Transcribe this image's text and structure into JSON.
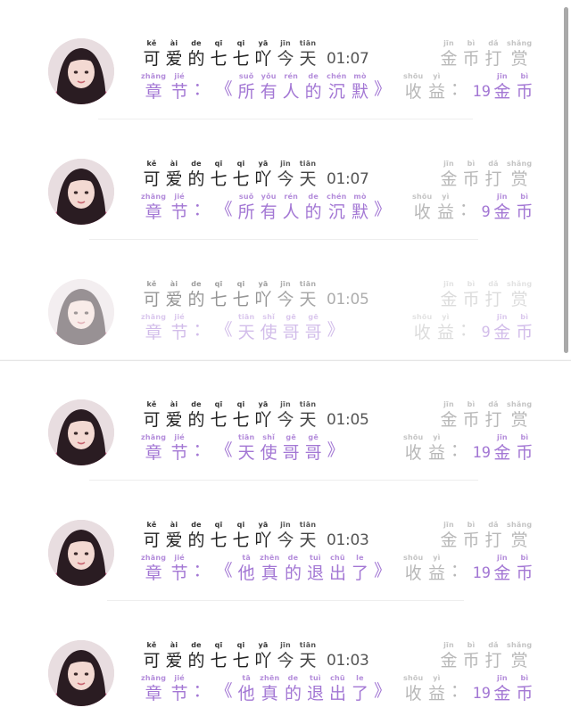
{
  "scrollbar": "vertical scroll bar",
  "colors": {
    "accent": "#a377d4",
    "muted": "#b8b8b8",
    "text": "#222222"
  },
  "rows": [
    {
      "name": [
        {
          "py": "kě",
          "hz": "可"
        },
        {
          "py": "ài",
          "hz": "爱"
        },
        {
          "py": "de",
          "hz": "的"
        },
        {
          "py": "qī",
          "hz": "七"
        },
        {
          "py": "qi",
          "hz": "七"
        },
        {
          "py": "yā",
          "hz": "吖"
        }
      ],
      "date": [
        {
          "py": "jīn",
          "hz": "今"
        },
        {
          "py": "tiān",
          "hz": "天"
        }
      ],
      "time": "01:07",
      "reward": [
        {
          "py": "jīn",
          "hz": "金"
        },
        {
          "py": "bì",
          "hz": "币"
        },
        {
          "py": "dǎ",
          "hz": "打"
        },
        {
          "py": "shǎng",
          "hz": "赏"
        }
      ],
      "chapter_label": [
        {
          "py": "zhāng",
          "hz": "章"
        },
        {
          "py": "jié",
          "hz": "节"
        },
        {
          "py": "",
          "hz": "："
        }
      ],
      "chapter_title": [
        {
          "py": "",
          "hz": "《"
        },
        {
          "py": "suǒ",
          "hz": "所"
        },
        {
          "py": "yǒu",
          "hz": "有"
        },
        {
          "py": "rén",
          "hz": "人"
        },
        {
          "py": "de",
          "hz": "的"
        },
        {
          "py": "chén",
          "hz": "沉"
        },
        {
          "py": "mò",
          "hz": "默"
        },
        {
          "py": "",
          "hz": "》"
        }
      ],
      "income_label": [
        {
          "py": "shōu",
          "hz": "收"
        },
        {
          "py": "yì",
          "hz": "益"
        },
        {
          "py": "",
          "hz": "："
        }
      ],
      "income_amount": "19",
      "income_unit": [
        {
          "py": "jīn",
          "hz": "金"
        },
        {
          "py": "bì",
          "hz": "币"
        }
      ]
    },
    {
      "name": [
        {
          "py": "kě",
          "hz": "可"
        },
        {
          "py": "ài",
          "hz": "爱"
        },
        {
          "py": "de",
          "hz": "的"
        },
        {
          "py": "qī",
          "hz": "七"
        },
        {
          "py": "qi",
          "hz": "七"
        },
        {
          "py": "yā",
          "hz": "吖"
        }
      ],
      "date": [
        {
          "py": "jīn",
          "hz": "今"
        },
        {
          "py": "tiān",
          "hz": "天"
        }
      ],
      "time": "01:07",
      "reward": [
        {
          "py": "jīn",
          "hz": "金"
        },
        {
          "py": "bì",
          "hz": "币"
        },
        {
          "py": "dǎ",
          "hz": "打"
        },
        {
          "py": "shǎng",
          "hz": "赏"
        }
      ],
      "chapter_label": [
        {
          "py": "zhāng",
          "hz": "章"
        },
        {
          "py": "jié",
          "hz": "节"
        },
        {
          "py": "",
          "hz": "："
        }
      ],
      "chapter_title": [
        {
          "py": "",
          "hz": "《"
        },
        {
          "py": "suǒ",
          "hz": "所"
        },
        {
          "py": "yǒu",
          "hz": "有"
        },
        {
          "py": "rén",
          "hz": "人"
        },
        {
          "py": "de",
          "hz": "的"
        },
        {
          "py": "chén",
          "hz": "沉"
        },
        {
          "py": "mò",
          "hz": "默"
        },
        {
          "py": "",
          "hz": "》"
        }
      ],
      "income_label": [
        {
          "py": "shōu",
          "hz": "收"
        },
        {
          "py": "yì",
          "hz": "益"
        },
        {
          "py": "",
          "hz": "："
        }
      ],
      "income_amount": "9",
      "income_unit": [
        {
          "py": "jīn",
          "hz": "金"
        },
        {
          "py": "bì",
          "hz": "币"
        }
      ]
    },
    {
      "faded": true,
      "name": [
        {
          "py": "kě",
          "hz": "可"
        },
        {
          "py": "ài",
          "hz": "爱"
        },
        {
          "py": "de",
          "hz": "的"
        },
        {
          "py": "qī",
          "hz": "七"
        },
        {
          "py": "qi",
          "hz": "七"
        },
        {
          "py": "yā",
          "hz": "吖"
        }
      ],
      "date": [
        {
          "py": "jīn",
          "hz": "今"
        },
        {
          "py": "tiān",
          "hz": "天"
        }
      ],
      "time": "01:05",
      "reward": [
        {
          "py": "jīn",
          "hz": "金"
        },
        {
          "py": "bì",
          "hz": "币"
        },
        {
          "py": "dǎ",
          "hz": "打"
        },
        {
          "py": "shǎng",
          "hz": "赏"
        }
      ],
      "chapter_label": [
        {
          "py": "zhāng",
          "hz": "章"
        },
        {
          "py": "jié",
          "hz": "节"
        },
        {
          "py": "",
          "hz": "："
        }
      ],
      "chapter_title": [
        {
          "py": "",
          "hz": "《"
        },
        {
          "py": "tiān",
          "hz": "天"
        },
        {
          "py": "shǐ",
          "hz": "使"
        },
        {
          "py": "gē",
          "hz": "哥"
        },
        {
          "py": "gē",
          "hz": "哥"
        },
        {
          "py": "",
          "hz": "》"
        }
      ],
      "income_label": [
        {
          "py": "shōu",
          "hz": "收"
        },
        {
          "py": "yì",
          "hz": "益"
        },
        {
          "py": "",
          "hz": "："
        }
      ],
      "income_amount": "9",
      "income_unit": [
        {
          "py": "jīn",
          "hz": "金"
        },
        {
          "py": "bì",
          "hz": "币"
        }
      ]
    },
    {
      "name": [
        {
          "py": "kě",
          "hz": "可"
        },
        {
          "py": "ài",
          "hz": "爱"
        },
        {
          "py": "de",
          "hz": "的"
        },
        {
          "py": "qī",
          "hz": "七"
        },
        {
          "py": "qi",
          "hz": "七"
        },
        {
          "py": "yā",
          "hz": "吖"
        }
      ],
      "date": [
        {
          "py": "jīn",
          "hz": "今"
        },
        {
          "py": "tiān",
          "hz": "天"
        }
      ],
      "time": "01:05",
      "reward": [
        {
          "py": "jīn",
          "hz": "金"
        },
        {
          "py": "bì",
          "hz": "币"
        },
        {
          "py": "dǎ",
          "hz": "打"
        },
        {
          "py": "shǎng",
          "hz": "赏"
        }
      ],
      "chapter_label": [
        {
          "py": "zhāng",
          "hz": "章"
        },
        {
          "py": "jié",
          "hz": "节"
        },
        {
          "py": "",
          "hz": "："
        }
      ],
      "chapter_title": [
        {
          "py": "",
          "hz": "《"
        },
        {
          "py": "tiān",
          "hz": "天"
        },
        {
          "py": "shǐ",
          "hz": "使"
        },
        {
          "py": "gē",
          "hz": "哥"
        },
        {
          "py": "gē",
          "hz": "哥"
        },
        {
          "py": "",
          "hz": "》"
        }
      ],
      "income_label": [
        {
          "py": "shōu",
          "hz": "收"
        },
        {
          "py": "yì",
          "hz": "益"
        },
        {
          "py": "",
          "hz": "："
        }
      ],
      "income_amount": "19",
      "income_unit": [
        {
          "py": "jīn",
          "hz": "金"
        },
        {
          "py": "bì",
          "hz": "币"
        }
      ]
    },
    {
      "name": [
        {
          "py": "kě",
          "hz": "可"
        },
        {
          "py": "ài",
          "hz": "爱"
        },
        {
          "py": "de",
          "hz": "的"
        },
        {
          "py": "qī",
          "hz": "七"
        },
        {
          "py": "qi",
          "hz": "七"
        },
        {
          "py": "yā",
          "hz": "吖"
        }
      ],
      "date": [
        {
          "py": "jīn",
          "hz": "今"
        },
        {
          "py": "tiān",
          "hz": "天"
        }
      ],
      "time": "01:03",
      "reward": [
        {
          "py": "jīn",
          "hz": "金"
        },
        {
          "py": "bì",
          "hz": "币"
        },
        {
          "py": "dǎ",
          "hz": "打"
        },
        {
          "py": "shǎng",
          "hz": "赏"
        }
      ],
      "chapter_label": [
        {
          "py": "zhāng",
          "hz": "章"
        },
        {
          "py": "jié",
          "hz": "节"
        },
        {
          "py": "",
          "hz": "："
        }
      ],
      "chapter_title": [
        {
          "py": "",
          "hz": "《"
        },
        {
          "py": "tā",
          "hz": "他"
        },
        {
          "py": "zhēn",
          "hz": "真"
        },
        {
          "py": "de",
          "hz": "的"
        },
        {
          "py": "tuì",
          "hz": "退"
        },
        {
          "py": "chū",
          "hz": "出"
        },
        {
          "py": "le",
          "hz": "了"
        },
        {
          "py": "",
          "hz": "》"
        }
      ],
      "income_label": [
        {
          "py": "shōu",
          "hz": "收"
        },
        {
          "py": "yì",
          "hz": "益"
        },
        {
          "py": "",
          "hz": "："
        }
      ],
      "income_amount": "19",
      "income_unit": [
        {
          "py": "jīn",
          "hz": "金"
        },
        {
          "py": "bì",
          "hz": "币"
        }
      ]
    },
    {
      "name": [
        {
          "py": "kě",
          "hz": "可"
        },
        {
          "py": "ài",
          "hz": "爱"
        },
        {
          "py": "de",
          "hz": "的"
        },
        {
          "py": "qī",
          "hz": "七"
        },
        {
          "py": "qi",
          "hz": "七"
        },
        {
          "py": "yā",
          "hz": "吖"
        }
      ],
      "date": [
        {
          "py": "jīn",
          "hz": "今"
        },
        {
          "py": "tiān",
          "hz": "天"
        }
      ],
      "time": "01:03",
      "reward": [
        {
          "py": "jīn",
          "hz": "金"
        },
        {
          "py": "bì",
          "hz": "币"
        },
        {
          "py": "dǎ",
          "hz": "打"
        },
        {
          "py": "shǎng",
          "hz": "赏"
        }
      ],
      "chapter_label": [
        {
          "py": "zhāng",
          "hz": "章"
        },
        {
          "py": "jié",
          "hz": "节"
        },
        {
          "py": "",
          "hz": "："
        }
      ],
      "chapter_title": [
        {
          "py": "",
          "hz": "《"
        },
        {
          "py": "tā",
          "hz": "他"
        },
        {
          "py": "zhēn",
          "hz": "真"
        },
        {
          "py": "de",
          "hz": "的"
        },
        {
          "py": "tuì",
          "hz": "退"
        },
        {
          "py": "chū",
          "hz": "出"
        },
        {
          "py": "le",
          "hz": "了"
        },
        {
          "py": "",
          "hz": "》"
        }
      ],
      "income_label": [
        {
          "py": "shōu",
          "hz": "收"
        },
        {
          "py": "yì",
          "hz": "益"
        },
        {
          "py": "",
          "hz": "："
        }
      ],
      "income_amount": "19",
      "income_unit": [
        {
          "py": "jīn",
          "hz": "金"
        },
        {
          "py": "bì",
          "hz": "币"
        }
      ]
    }
  ]
}
